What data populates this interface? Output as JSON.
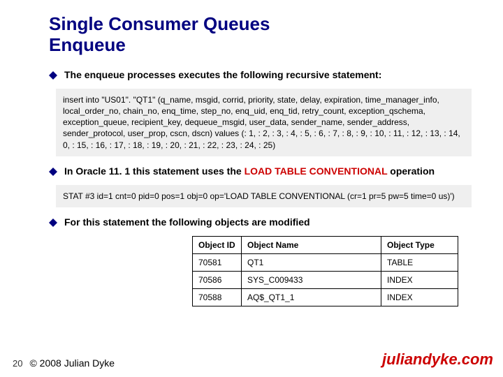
{
  "title_line1": "Single Consumer Queues",
  "title_line2": "Enqueue",
  "bullets": {
    "b1": "The enqueue processes executes the following recursive statement:",
    "b2_prefix": "In Oracle 11. 1 this statement uses the ",
    "b2_op": "LOAD TABLE CONVENTIONAL",
    "b2_suffix": " operation",
    "b3": "For this statement the following objects are modified"
  },
  "code1": "insert into \"US01\". \"QT1\"  (q_name, msgid, corrid, priority, state, delay, expiration, time_manager_info, local_order_no, chain_no, enq_time, step_no, enq_uid,   enq_tid, retry_count, exception_qschema, exception_queue, recipient_key,   dequeue_msgid, user_data, sender_name, sender_address, sender_protocol,   user_prop, cscn, dscn)   values (: 1, : 2, : 3, : 4, : 5, : 6, : 7, : 8, : 9, : 10, : 11, : 12, : 13, : 14, 0, : 15, : 16, : 17, : 18, : 19, : 20, : 21, : 22, : 23, : 24, : 25)",
  "code2": "STAT #3 id=1 cnt=0 pid=0 pos=1 obj=0 op='LOAD TABLE CONVENTIONAL  (cr=1 pr=5 pw=5 time=0 us)')",
  "table": {
    "headers": {
      "id": "Object ID",
      "name": "Object Name",
      "type": "Object Type"
    },
    "rows": [
      {
        "id": "70581",
        "name": "QT1",
        "type": "TABLE"
      },
      {
        "id": "70586",
        "name": "SYS_C009433",
        "type": "INDEX"
      },
      {
        "id": "70588",
        "name": "AQ$_QT1_1",
        "type": "INDEX"
      }
    ]
  },
  "footer": {
    "page": "20",
    "copyright": "© 2008 Julian Dyke",
    "site": "juliandyke.com"
  }
}
